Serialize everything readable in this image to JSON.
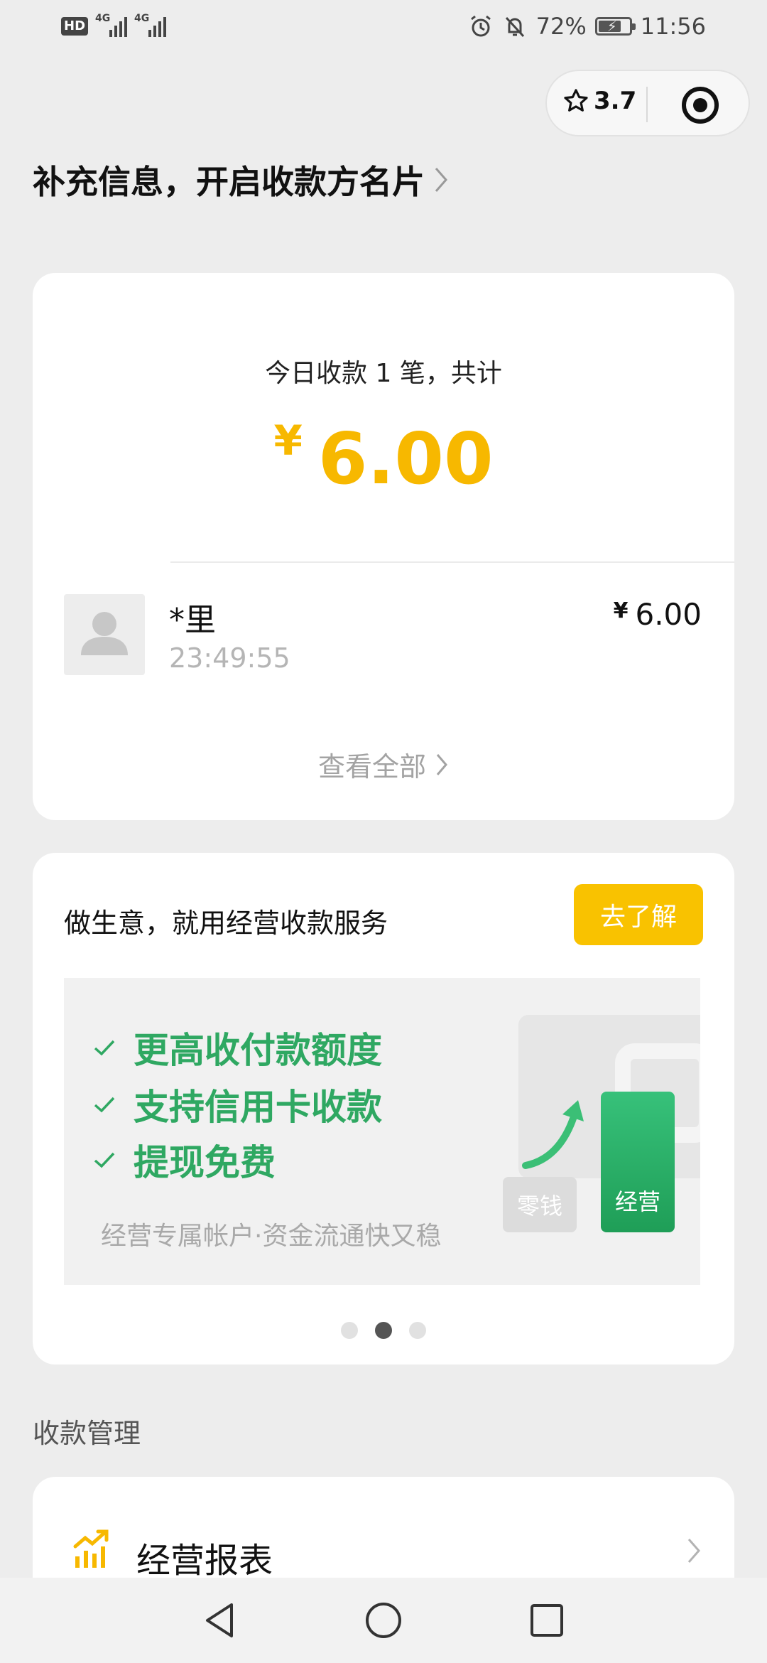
{
  "status_bar": {
    "hd_label": "HD",
    "network_1": "4G",
    "network_2": "4G",
    "battery_percent": "72%",
    "battery_level": 0.72,
    "time": "11:56",
    "icons": [
      "alarm-icon",
      "mute-icon",
      "battery-charging-icon"
    ]
  },
  "capsule": {
    "rating": "3.7",
    "icons": [
      "star-icon",
      "target-icon"
    ]
  },
  "header": {
    "link_text": "补充信息，开启收款方名片"
  },
  "today": {
    "label": "今日收款 1 笔，共计",
    "currency": "¥",
    "amount": "6.00"
  },
  "transaction": {
    "name": "*里",
    "time": "23:49:55",
    "currency": "¥",
    "amount": "6.00"
  },
  "view_all": "查看全部",
  "promo": {
    "title": "做生意，就用经营收款服务",
    "button": "去了解",
    "features": [
      "更高收付款额度",
      "支持信用卡收款",
      "提现免费"
    ],
    "subtitle": "经营专属帐户·资金流通快又稳",
    "card_small": "零钱",
    "card_green": "经营",
    "carousel_active_index": 1,
    "carousel_count": 3
  },
  "section_label": "收款管理",
  "report": {
    "label": "经营报表"
  },
  "colors": {
    "accent_yellow": "#f7b800",
    "button_yellow": "#f9c200",
    "feature_green": "#2fa862",
    "background": "#ededed"
  }
}
